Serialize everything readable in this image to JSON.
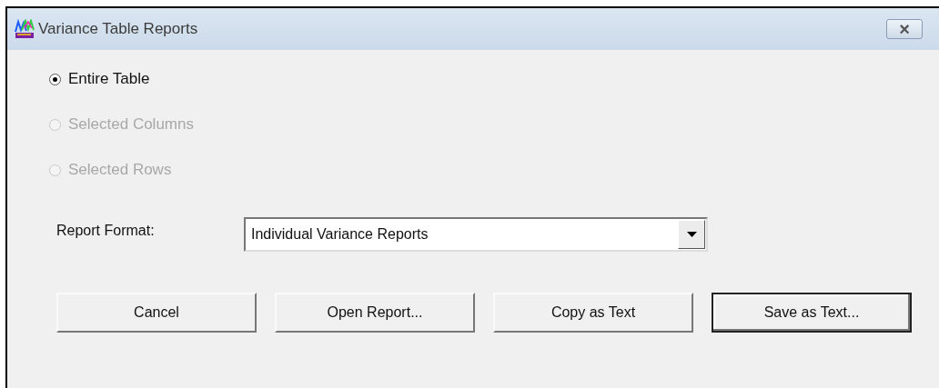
{
  "window": {
    "title": "Variance Table Reports",
    "close": "×"
  },
  "scope_options": [
    {
      "label": "Entire Table",
      "selected": true,
      "disabled": false
    },
    {
      "label": "Selected Columns",
      "selected": false,
      "disabled": true
    },
    {
      "label": "Selected Rows",
      "selected": false,
      "disabled": true
    }
  ],
  "report_format": {
    "label": "Report Format:",
    "value": "Individual Variance Reports"
  },
  "buttons": [
    {
      "label": "Cancel",
      "default": false
    },
    {
      "label": "Open Report...",
      "default": false
    },
    {
      "label": "Copy as Text",
      "default": false
    },
    {
      "label": "Save as Text...",
      "default": true
    }
  ]
}
